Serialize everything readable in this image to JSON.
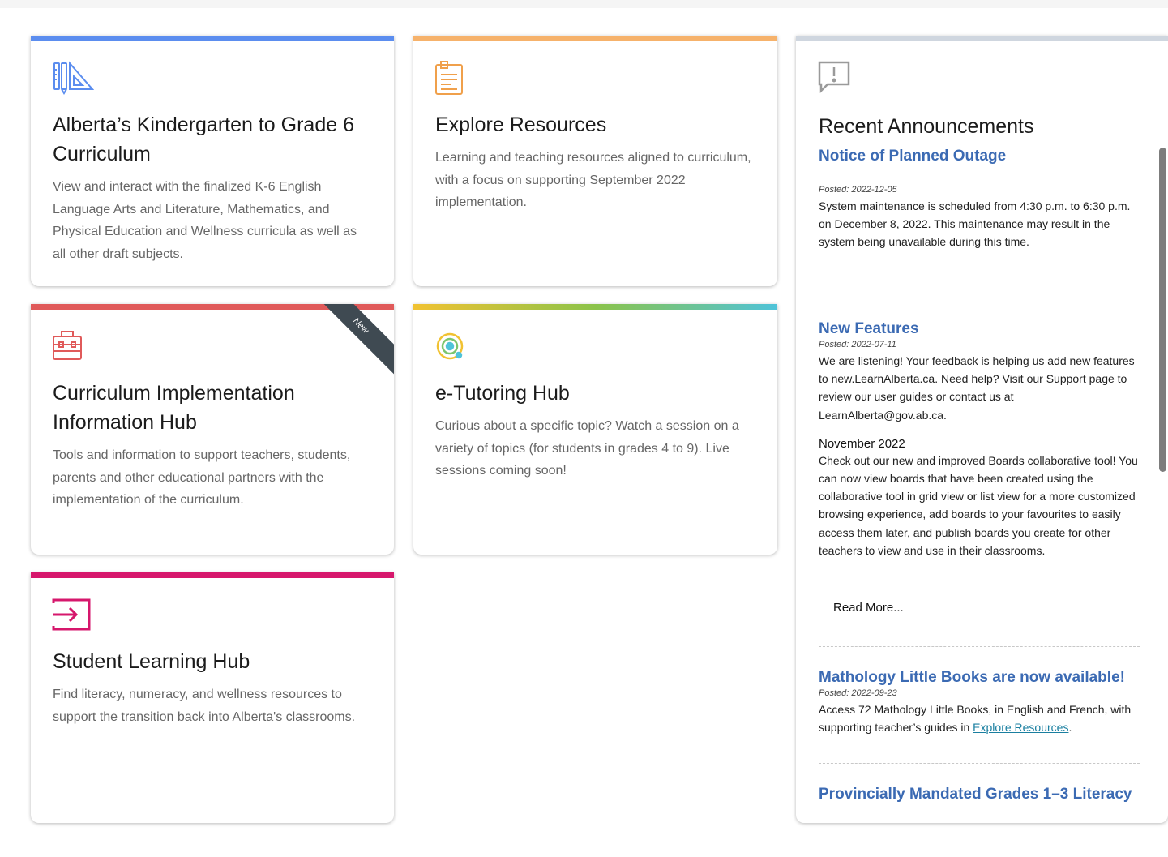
{
  "cards": [
    {
      "id": "k6",
      "title": "Alberta’s Kindergarten to Grade 6 Curriculum",
      "description": "View and interact with the finalized K-6 English Language Arts and Literature, Mathematics, and Physical Education and Wellness curricula as well as all other draft subjects.",
      "accent": "#5b8def",
      "icon": "ruler-triangle-icon"
    },
    {
      "id": "explore",
      "title": "Explore Resources",
      "description": "Learning and teaching resources aligned to curriculum, with a focus on supporting September 2022 implementation.",
      "accent": "#f6b26b",
      "icon": "clipboard-icon"
    },
    {
      "id": "implementation",
      "title": "Curriculum Implementation Information Hub",
      "description": "Tools and information to support teachers, students, parents and other educational partners with the implementation of the curriculum.",
      "accent": "#e05a5a",
      "icon": "toolbox-icon",
      "ribbon": "New"
    },
    {
      "id": "etutoring",
      "title": "e-Tutoring Hub",
      "description": "Curious about a specific topic? Watch a session on a variety of topics (for students in grades 4 to 9). Live sessions coming soon!",
      "accent": "gradient",
      "icon": "orbit-icon"
    },
    {
      "id": "student",
      "title": "Student Learning Hub",
      "description": "Find literacy, numeracy, and wellness resources to support the transition back into Alberta's classrooms.",
      "accent": "#d6176c",
      "icon": "login-arrow-icon"
    }
  ],
  "announcements": {
    "title": "Recent Announcements",
    "accent": "#cfd6df",
    "icon": "alert-message-icon",
    "items": [
      {
        "link": "Notice of Planned Outage",
        "date": "Posted: 2022-12-05",
        "body": "System maintenance is scheduled from 4:30 p.m. to 6:30 p.m. on December 8, 2022. This maintenance may result in the system being unavailable during this time."
      },
      {
        "link": "New Features",
        "date": "Posted: 2022-07-11",
        "body": "We are listening! Your feedback is helping us add new features to new.LearnAlberta.ca. Need help? Visit our Support page to review our user guides or contact us at LearnAlberta@gov.ab.ca.",
        "subheading": "November 2022",
        "sub_body": "Check out our new and improved Boards collaborative tool! You can now view boards that have been created using the collaborative tool in grid view or list view for a more customized browsing experience, add boards to your favourites to easily access them later, and publish boards you create for other teachers to view and use in their classrooms.",
        "read_more": "Read More..."
      },
      {
        "link": "Mathology Little Books are now available!",
        "date": "Posted: 2022-09-23",
        "body_prefix": "Access 72 Mathology Little Books, in English and French, with supporting teacher’s guides in ",
        "body_link": "Explore Resources",
        "body_suffix": "."
      },
      {
        "link": "Provincially Mandated Grades 1–3 Literacy"
      }
    ]
  }
}
